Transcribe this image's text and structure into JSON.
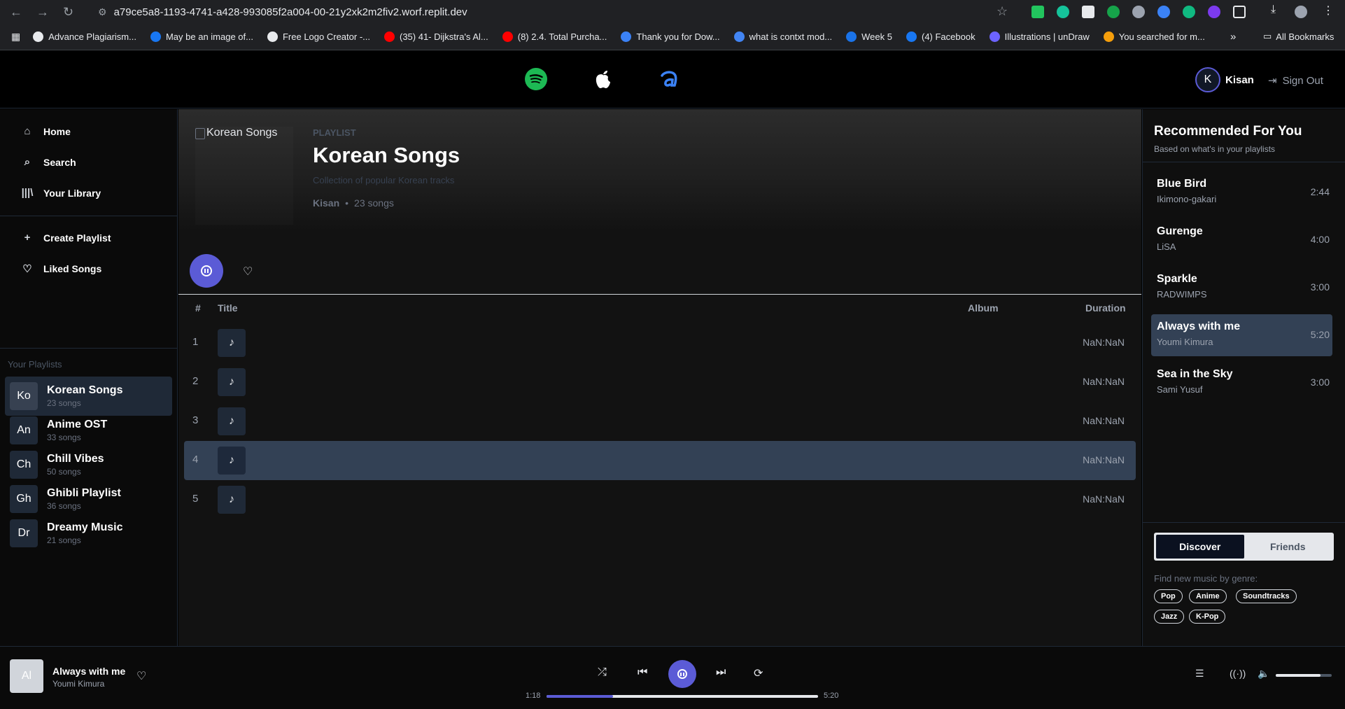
{
  "browser": {
    "url": "a79ce5a8-1193-4741-a428-993085f2a004-00-21y2xk2m2fiv2.worf.replit.dev",
    "bookmarks": [
      {
        "label": "Advance Plagiarism...",
        "color": "#e8eaed"
      },
      {
        "label": "May be an image of...",
        "color": "#1877f2"
      },
      {
        "label": "Free Logo Creator -...",
        "color": "#e8eaed"
      },
      {
        "label": "(35) 41- Dijkstra's Al...",
        "color": "#ff0000"
      },
      {
        "label": "(8) 2.4. Total Purcha...",
        "color": "#ff0000"
      },
      {
        "label": "Thank you for Dow...",
        "color": "#3b82f6"
      },
      {
        "label": "what is contxt mod...",
        "color": "#4285f4"
      },
      {
        "label": "Week 5",
        "color": "#1a73e8"
      },
      {
        "label": "(4) Facebook",
        "color": "#1877f2"
      },
      {
        "label": "Illustrations | unDraw",
        "color": "#6c63ff"
      },
      {
        "label": "You searched for m...",
        "color": "#f59e0b"
      }
    ],
    "all_bookmarks": "All Bookmarks"
  },
  "topbar": {
    "user_initial": "K",
    "user_name": "Kisan",
    "sign_out": "Sign Out"
  },
  "sidebar": {
    "nav": [
      {
        "label": "Home",
        "icon": "home-icon"
      },
      {
        "label": "Search",
        "icon": "search-icon"
      },
      {
        "label": "Your Library",
        "icon": "library-icon"
      }
    ],
    "actions": [
      {
        "label": "Create Playlist",
        "icon": "plus-icon"
      },
      {
        "label": "Liked Songs",
        "icon": "heart-icon"
      }
    ],
    "playlists_heading": "Your Playlists",
    "playlists": [
      {
        "badge": "Ko",
        "name": "Korean Songs",
        "count": "23 songs",
        "active": true
      },
      {
        "badge": "An",
        "name": "Anime OST",
        "count": "33 songs",
        "active": false
      },
      {
        "badge": "Ch",
        "name": "Chill Vibes",
        "count": "50 songs",
        "active": false
      },
      {
        "badge": "Gh",
        "name": "Ghibli Playlist",
        "count": "36 songs",
        "active": false
      },
      {
        "badge": "Dr",
        "name": "Dreamy Music",
        "count": "21 songs",
        "active": false
      }
    ]
  },
  "playlist": {
    "cover_alt": "Korean Songs",
    "type": "PLAYLIST",
    "title": "Korean Songs",
    "description": "Collection of popular Korean tracks",
    "owner": "Kisan",
    "dot": "•",
    "song_count": "23 songs",
    "columns": {
      "num": "#",
      "title": "Title",
      "album": "Album",
      "duration": "Duration"
    },
    "tracks": [
      {
        "num": "1",
        "duration": "NaN:NaN",
        "active": false
      },
      {
        "num": "2",
        "duration": "NaN:NaN",
        "active": false
      },
      {
        "num": "3",
        "duration": "NaN:NaN",
        "active": false
      },
      {
        "num": "4",
        "duration": "NaN:NaN",
        "active": true
      },
      {
        "num": "5",
        "duration": "NaN:NaN",
        "active": false
      }
    ]
  },
  "recommended": {
    "title": "Recommended For You",
    "subtitle": "Based on what's in your playlists",
    "items": [
      {
        "name": "Blue Bird",
        "artist": "Ikimono-gakari",
        "duration": "2:44",
        "active": false
      },
      {
        "name": "Gurenge",
        "artist": "LiSA",
        "duration": "4:00",
        "active": false
      },
      {
        "name": "Sparkle",
        "artist": "RADWIMPS",
        "duration": "3:00",
        "active": false
      },
      {
        "name": "Always with me",
        "artist": "Youmi Kimura",
        "duration": "5:20",
        "active": true
      },
      {
        "name": "Sea in the Sky",
        "artist": "Sami Yusuf",
        "duration": "3:00",
        "active": false
      }
    ],
    "tabs": {
      "discover": "Discover",
      "friends": "Friends",
      "selected": "Discover"
    },
    "genre_label": "Find new music by genre:",
    "genres": [
      "Pop",
      "Anime",
      "Soundtracks",
      "Jazz",
      "K-Pop"
    ]
  },
  "player": {
    "art_initials": "Al",
    "title": "Always with me",
    "artist": "Youmi Kimura",
    "current_time": "1:18",
    "total_time": "5:20",
    "progress": 0.244,
    "volume": 0.8
  },
  "colors": {
    "accent": "#5b5bd6",
    "spotify": "#1db954",
    "third_service": "#3b82f6"
  }
}
